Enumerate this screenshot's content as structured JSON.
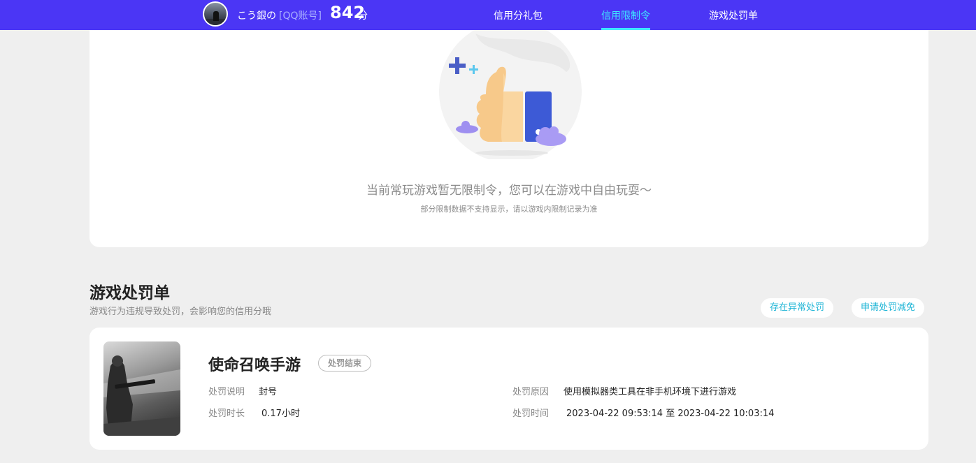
{
  "header": {
    "user_name": "こう銀の",
    "account_type": "[QQ账号]",
    "score": "842",
    "score_unit": "分",
    "tabs": [
      {
        "label": "信用分礼包",
        "active": false
      },
      {
        "label": "信用限制令",
        "active": true
      },
      {
        "label": "游戏处罚单",
        "active": false
      }
    ]
  },
  "restriction": {
    "empty_title": "当前常玩游戏暂无限制令，您可以在游戏中自由玩耍～",
    "empty_subtitle": "部分限制数据不支持显示，请以游戏内限制记录为准"
  },
  "penalty_section": {
    "title": "游戏处罚单",
    "description": "游戏行为违规导致处罚，会影响您的信用分哦",
    "buttons": {
      "abnormal": "存在异常处罚",
      "reduce": "申请处罚减免"
    },
    "records": [
      {
        "game": "使命召唤手游",
        "status": "处罚结束",
        "desc_label": "处罚说明",
        "desc_value": "封号",
        "duration_label": "处罚时长",
        "duration_value": "0.17小时",
        "reason_label": "处罚原因",
        "reason_value": "使用模拟器类工具在非手机环境下进行游戏",
        "time_label": "处罚时间",
        "time_value": "2023-04-22 09:53:14 至 2023-04-22 10:03:14"
      }
    ]
  },
  "colors": {
    "topbar": "#4b36f5",
    "active_tab": "#3ee8ff",
    "link": "#1fb5d6",
    "background": "#efefef"
  }
}
